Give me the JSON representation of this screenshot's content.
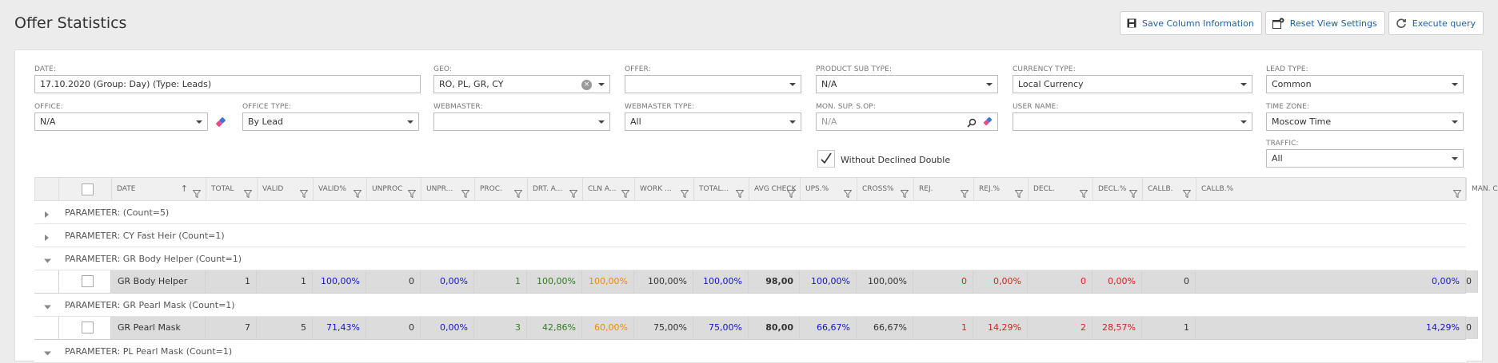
{
  "header": {
    "title": "Offer Statistics",
    "buttons": {
      "save": "Save Column Information",
      "reset": "Reset View Settings",
      "execute": "Execute query"
    }
  },
  "filters": {
    "date": {
      "label": "DATE:",
      "value": "17.10.2020 (Group: Day) (Type: Leads)"
    },
    "geo": {
      "label": "GEO:",
      "value": "RO, PL, GR, CY"
    },
    "offer": {
      "label": "OFFER:",
      "value": ""
    },
    "product_sub_type": {
      "label": "PRODUCT SUB TYPE:",
      "value": "N/A"
    },
    "currency_type": {
      "label": "CURRENCY TYPE:",
      "value": "Local Currency"
    },
    "lead_type": {
      "label": "LEAD TYPE:",
      "value": "Common"
    },
    "office": {
      "label": "OFFICE:",
      "value": "N/A"
    },
    "office_type": {
      "label": "OFFICE TYPE:",
      "value": "By Lead"
    },
    "webmaster": {
      "label": "WEBMASTER:",
      "value": ""
    },
    "webmaster_type": {
      "label": "WEBMASTER TYPE:",
      "value": "All"
    },
    "mon_sup": {
      "label": "MON. SUP. S.OP:",
      "placeholder": "N/A"
    },
    "user_name": {
      "label": "USER NAME:",
      "value": ""
    },
    "time_zone": {
      "label": "TIME ZONE:",
      "value": "Moscow Time"
    },
    "traffic": {
      "label": "TRAFFIC:",
      "value": "All"
    },
    "without_declined_double": {
      "label": "Without Declined Double",
      "checked": true
    }
  },
  "grid": {
    "columns": [
      "DATE",
      "TOTAL",
      "VALID",
      "VALID%",
      "UNPROC",
      "UNPR...",
      "PROC.",
      "DRT. A...",
      "CLN A...",
      "WORK ...",
      "TOTAL...",
      "AVG CHECK",
      "UPS.%",
      "CROSS%",
      "REJ.",
      "REJ.%",
      "DECL.",
      "DECL.%",
      "CALLB.",
      "CALLB.%",
      "MAN. CAL..."
    ],
    "sort_indicator": "↑",
    "groups": [
      {
        "label": "PARAMETER: (Count=5)",
        "expanded": false
      },
      {
        "label": "PARAMETER: CY Fast Heir (Count=1)",
        "expanded": false
      },
      {
        "label": "PARAMETER: GR Body Helper (Count=1)",
        "expanded": true,
        "row": {
          "name": "GR Body Helper",
          "values": [
            "1",
            "1",
            "100,00%",
            "0",
            "0,00%",
            "1",
            "100,00%",
            "100,00%",
            "100,00%",
            "100,00%",
            "98,00",
            "100,00%",
            "100,00%",
            "0",
            "0,00%",
            "0",
            "0,00%",
            "0",
            "0,00%",
            "0"
          ]
        }
      },
      {
        "label": "PARAMETER: GR Pearl Mask (Count=1)",
        "expanded": true,
        "row": {
          "name": "GR Pearl Mask",
          "values": [
            "7",
            "5",
            "71,43%",
            "0",
            "0,00%",
            "3",
            "42,86%",
            "60,00%",
            "75,00%",
            "75,00%",
            "80,00",
            "66,67%",
            "66,67%",
            "1",
            "14,29%",
            "2",
            "28,57%",
            "1",
            "14,29%",
            "0"
          ]
        }
      },
      {
        "label": "PARAMETER: PL Pearl Mask (Count=1)",
        "expanded": true
      }
    ]
  },
  "colors": {
    "link": "#1f5fa8",
    "blue_value": "#1515c8",
    "green_value": "#2e7d1e",
    "orange_value": "#ee8a00",
    "red_value": "#d42020"
  }
}
